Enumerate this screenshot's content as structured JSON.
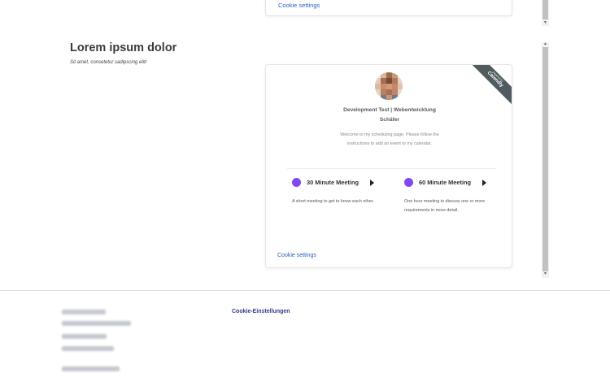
{
  "top_widget": {
    "cookie_label": "Cookie settings"
  },
  "section": {
    "title": "Lorem ipsum dolor",
    "subtitle": "Sit amet, consetetur sadipscing elitr"
  },
  "widget": {
    "ribbon_small": "powered by",
    "ribbon_big": "Calendly",
    "host_line1": "Development Test | Webentwicklung",
    "host_line2": "Schäfer",
    "welcome_text": "Welcome to my scheduling page. Please follow the instructions to add an event to my calendar.",
    "events": [
      {
        "name": "30 Minute Meeting",
        "description": "A short meeting to get to know each other.",
        "dot_color": "#8247f5"
      },
      {
        "name": "60 Minute Meeting",
        "description": "One hour meeting to discuss one or more requirements in more detail.",
        "dot_color": "#8247f5"
      }
    ],
    "cookie_label": "Cookie settings",
    "accent_color": "#2a5fc1"
  },
  "footer": {
    "cookie_label": "Cookie-Einstellungen"
  }
}
